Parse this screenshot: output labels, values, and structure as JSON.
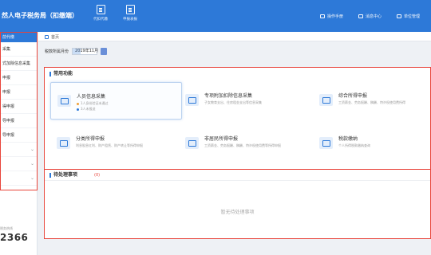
{
  "header": {
    "app_title": "然人电子税务局（扣缴端）",
    "buttons": [
      {
        "label": "代扣代缴",
        "icon": "document-icon"
      },
      {
        "label": "申报表报",
        "icon": "excel-icon"
      }
    ],
    "right_links": [
      {
        "label": "操作手册",
        "icon": "book-icon"
      },
      {
        "label": "消息中心",
        "icon": "mail-icon"
      },
      {
        "label": "单位管理",
        "icon": "building-icon"
      }
    ]
  },
  "sidebar": {
    "active_item": "前代缴",
    "items": [
      {
        "label": "采集",
        "expandable": false
      },
      {
        "label": "式加除信息采集",
        "expandable": false
      },
      {
        "label": "申报",
        "expandable": false
      },
      {
        "label": "申报",
        "expandable": false
      },
      {
        "label": "得申报",
        "expandable": false
      },
      {
        "label": "导申报",
        "expandable": false
      },
      {
        "label": "导申报",
        "expandable": false
      },
      {
        "label": "",
        "expandable": true
      },
      {
        "label": "",
        "expandable": true
      },
      {
        "label": "",
        "expandable": true
      },
      {
        "label": "",
        "expandable": true
      }
    ],
    "footer_label": "税务热线",
    "footer_number": "2366"
  },
  "breadcrumb": {
    "home": "首页"
  },
  "period": {
    "label": "税款所属月份",
    "value": "2019年11月"
  },
  "functions": {
    "title": "常用功能",
    "cards": [
      {
        "title": "人员信息采集",
        "lines": [
          {
            "dot": "orange",
            "text": "1人身份验证未通过"
          },
          {
            "dot": "blue",
            "text": "3人未报送"
          }
        ],
        "icon": "person-card-icon",
        "selected": true
      },
      {
        "title": "专项附加扣除信息采集",
        "lines": [
          {
            "dot": "",
            "text": "子女教育支出、住房租金支出等信息采集"
          }
        ],
        "icon": "id-card-icon",
        "selected": false
      },
      {
        "title": "综合所得申报",
        "lines": [
          {
            "dot": "",
            "text": "工资薪金、劳务报酬、稿酬、特许权使用费所得"
          }
        ],
        "icon": "report-icon",
        "selected": false
      },
      {
        "title": "分类所得申报",
        "lines": [
          {
            "dot": "",
            "text": "利息股息红利、财产租赁、财产转让等所得申报"
          }
        ],
        "icon": "edit-form-icon",
        "selected": false
      },
      {
        "title": "非居民所得申报",
        "lines": [
          {
            "dot": "",
            "text": "工资薪金、劳务报酬、稿酬、特许权使用费等所得申报"
          }
        ],
        "icon": "edit-form-icon",
        "selected": false
      },
      {
        "title": "税款缴纳",
        "lines": [
          {
            "dot": "",
            "text": "个人所得税款缴纳查询"
          }
        ],
        "icon": "payment-icon",
        "selected": false
      }
    ]
  },
  "todo": {
    "title": "待处理事项",
    "count": "(0)",
    "empty_text": "暂无待处理事项"
  }
}
